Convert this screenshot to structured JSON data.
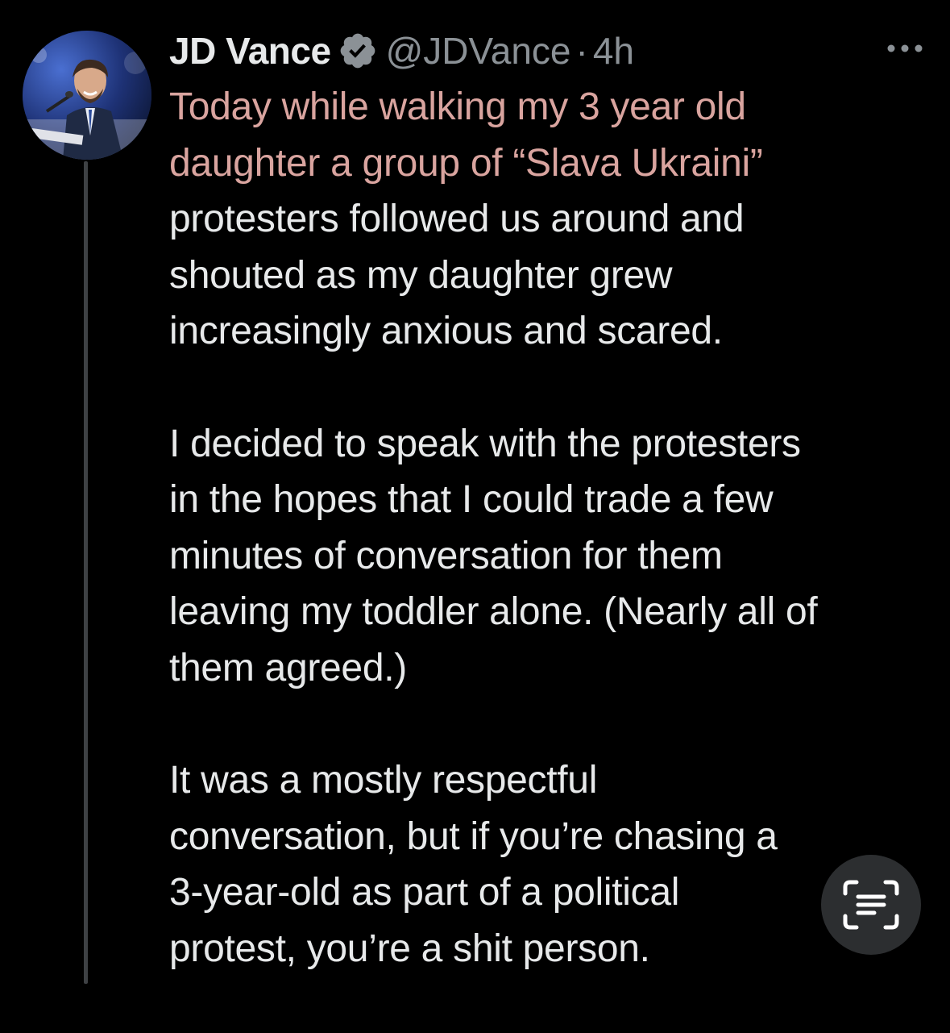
{
  "tweet": {
    "author": {
      "display_name": "JD Vance",
      "handle": "@JDVance",
      "verified": true,
      "avatar_icon": "profile-photo"
    },
    "separator": "·",
    "timestamp": "4h",
    "more_icon": "more-horizontal-icon",
    "paragraphs": [
      {
        "lines": [
          "Today while walking my 3 year old",
          "daughter a group of “Slava Ukraini”",
          "protesters followed us around and",
          "shouted as my daughter grew",
          "increasingly anxious and scared."
        ]
      },
      {
        "lines": [
          "I decided to speak with the protesters",
          "in the hopes that I could trade a few",
          "minutes of conversation for them",
          "leaving my toddler alone. (Nearly all of",
          "them agreed.)"
        ]
      },
      {
        "lines": [
          "It was a mostly respectful",
          "conversation,  but if you’re chasing a",
          "3-year-old as part of a political",
          "protest, you’re a shit person."
        ]
      }
    ]
  },
  "overlay": {
    "scan_text_icon": "live-text-scan-icon"
  },
  "colors": {
    "background": "#000000",
    "text": "#e7e9ea",
    "muted": "#8b9196",
    "verified": "#8b9196",
    "highlight_tint": "#d9a49f",
    "thread_line": "#3e4144"
  }
}
